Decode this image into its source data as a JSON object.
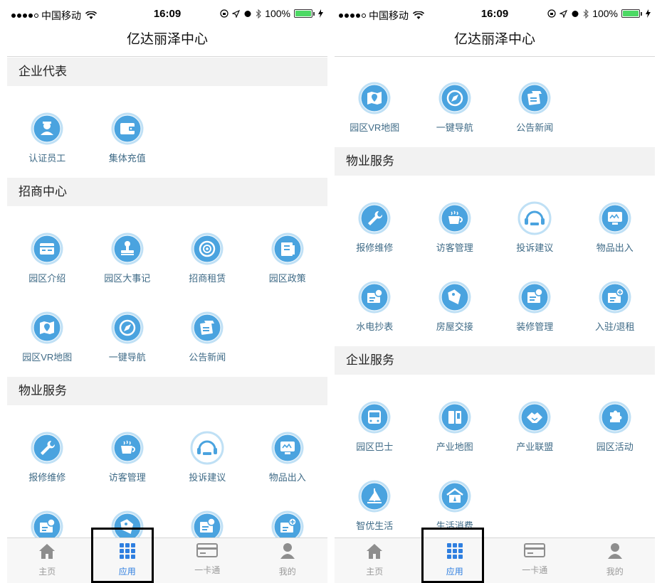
{
  "status_bar": {
    "carrier": "中国移动",
    "time": "16:09",
    "battery": "100%"
  },
  "nav": {
    "title": "亿达丽泽中心"
  },
  "sections": {
    "enterprise_rep": {
      "title": "企业代表",
      "items": [
        {
          "label": "认证员工",
          "icon": "employee-id-icon"
        },
        {
          "label": "集体充值",
          "icon": "wallet-icon"
        }
      ]
    },
    "investment": {
      "title": "招商中心",
      "items": [
        {
          "label": "园区介绍",
          "icon": "park-intro-icon"
        },
        {
          "label": "园区大事记",
          "icon": "stamp-icon"
        },
        {
          "label": "招商租赁",
          "icon": "target-icon"
        },
        {
          "label": "园区政策",
          "icon": "policy-doc-icon"
        },
        {
          "label": "园区VR地图",
          "icon": "map-pin-icon"
        },
        {
          "label": "一键导航",
          "icon": "compass-icon"
        },
        {
          "label": "公告新闻",
          "icon": "news-icon"
        }
      ]
    },
    "property": {
      "title": "物业服务",
      "items": [
        {
          "label": "报修维修",
          "icon": "wrench-icon"
        },
        {
          "label": "访客管理",
          "icon": "coffee-cup-icon"
        },
        {
          "label": "投诉建议",
          "icon": "headset-icon"
        },
        {
          "label": "物品出入",
          "icon": "monitor-icon"
        },
        {
          "label": "水电抄表",
          "icon": "meter-icon"
        },
        {
          "label": "房屋交接",
          "icon": "key-tag-icon"
        },
        {
          "label": "装修管理",
          "icon": "renovation-icon"
        },
        {
          "label": "入驻/退租",
          "icon": "move-in-icon"
        }
      ]
    },
    "enterprise_service": {
      "title": "企业服务",
      "items": [
        {
          "label": "园区巴士",
          "icon": "bus-icon"
        },
        {
          "label": "产业地图",
          "icon": "book-icon"
        },
        {
          "label": "产业联盟",
          "icon": "handshake-icon"
        },
        {
          "label": "园区活动",
          "icon": "puzzle-icon"
        },
        {
          "label": "智优生活",
          "icon": "sail-icon"
        },
        {
          "label": "生活消费",
          "icon": "shop-icon"
        }
      ]
    }
  },
  "tabs": [
    {
      "label": "主页",
      "icon": "home-icon"
    },
    {
      "label": "应用",
      "icon": "grid-apps-icon",
      "active": true
    },
    {
      "label": "一卡通",
      "icon": "card-icon"
    },
    {
      "label": "我的",
      "icon": "person-icon"
    }
  ],
  "colors": {
    "icon_blue": "#4aa3df",
    "icon_ring": "#bfe0f5",
    "label": "#3e6a86",
    "tab_active": "#2f7fe0",
    "tab_inactive": "#9a9a9a",
    "section_bg": "#f2f2f2"
  }
}
